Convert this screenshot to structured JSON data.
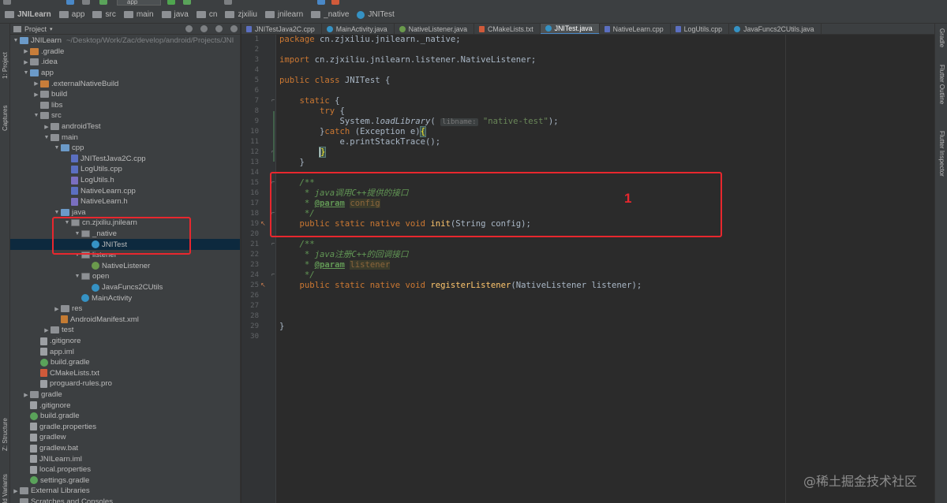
{
  "colors": {
    "annotation": "#e8272e",
    "keyword": "#cc7832",
    "string": "#6a8759",
    "comment": "#629755",
    "method": "#ffc66d",
    "selection": "#0d293e",
    "active_tab_underline": "#4a88c7"
  },
  "toolbar": {
    "run_config": "app"
  },
  "breadcrumb": [
    {
      "label": "JNILearn",
      "icon": "folder-icon"
    },
    {
      "label": "app",
      "icon": "folder-icon"
    },
    {
      "label": "src",
      "icon": "folder-icon"
    },
    {
      "label": "main",
      "icon": "folder-icon"
    },
    {
      "label": "java",
      "icon": "folder-icon"
    },
    {
      "label": "cn",
      "icon": "package-icon"
    },
    {
      "label": "zjxiliu",
      "icon": "package-icon"
    },
    {
      "label": "jnilearn",
      "icon": "package-icon"
    },
    {
      "label": "_native",
      "icon": "package-icon"
    },
    {
      "label": "JNITest",
      "icon": "class-icon"
    }
  ],
  "left_strip": {
    "project": "1: Project",
    "captures": "Captures",
    "structure": "Z: Structure",
    "build_variants": "Build Variants"
  },
  "right_strip": {
    "gradle": "Gradle",
    "flutter_outline": "Flutter Outline",
    "flutter_inspector": "Flutter Inspector"
  },
  "project_panel": {
    "title": "Project",
    "tree": [
      {
        "label": "JNILearn",
        "extra": "~/Desktop/Work/Zac/develop/android/Projects/JNI",
        "depth": 0,
        "arrow": "▼",
        "icon": "folder-blue"
      },
      {
        "label": ".gradle",
        "depth": 1,
        "arrow": "▶",
        "icon": "folder-orange"
      },
      {
        "label": ".idea",
        "depth": 1,
        "arrow": "▶",
        "icon": "folder"
      },
      {
        "label": "app",
        "depth": 1,
        "arrow": "▼",
        "icon": "folder-blue"
      },
      {
        "label": ".externalNativeBuild",
        "depth": 2,
        "arrow": "▶",
        "icon": "folder-orange"
      },
      {
        "label": "build",
        "depth": 2,
        "arrow": "▶",
        "icon": "folder"
      },
      {
        "label": "libs",
        "depth": 2,
        "arrow": "",
        "icon": "folder"
      },
      {
        "label": "src",
        "depth": 2,
        "arrow": "▼",
        "icon": "folder"
      },
      {
        "label": "androidTest",
        "depth": 3,
        "arrow": "▶",
        "icon": "folder"
      },
      {
        "label": "main",
        "depth": 3,
        "arrow": "▼",
        "icon": "folder"
      },
      {
        "label": "cpp",
        "depth": 4,
        "arrow": "▼",
        "icon": "folder-blue"
      },
      {
        "label": "JNITestJava2C.cpp",
        "depth": 5,
        "arrow": "",
        "icon": "cpp"
      },
      {
        "label": "LogUtils.cpp",
        "depth": 5,
        "arrow": "",
        "icon": "cpp"
      },
      {
        "label": "LogUtils.h",
        "depth": 5,
        "arrow": "",
        "icon": "h"
      },
      {
        "label": "NativeLearn.cpp",
        "depth": 5,
        "arrow": "",
        "icon": "cpp"
      },
      {
        "label": "NativeLearn.h",
        "depth": 5,
        "arrow": "",
        "icon": "h"
      },
      {
        "label": "java",
        "depth": 4,
        "arrow": "▼",
        "icon": "folder-blue"
      },
      {
        "label": "cn.zjxiliu.jnilearn",
        "depth": 5,
        "arrow": "▼",
        "icon": "pkg"
      },
      {
        "label": "_native",
        "depth": 6,
        "arrow": "▼",
        "icon": "pkg"
      },
      {
        "label": "JNITest",
        "depth": 7,
        "arrow": "",
        "icon": "cls",
        "selected": true
      },
      {
        "label": "listener",
        "depth": 6,
        "arrow": "▼",
        "icon": "pkg"
      },
      {
        "label": "NativeListener",
        "depth": 7,
        "arrow": "",
        "icon": "iface"
      },
      {
        "label": "open",
        "depth": 6,
        "arrow": "▼",
        "icon": "pkg"
      },
      {
        "label": "JavaFuncs2CUtils",
        "depth": 7,
        "arrow": "",
        "icon": "cls"
      },
      {
        "label": "MainActivity",
        "depth": 6,
        "arrow": "",
        "icon": "cls"
      },
      {
        "label": "res",
        "depth": 4,
        "arrow": "▶",
        "icon": "folder"
      },
      {
        "label": "AndroidManifest.xml",
        "depth": 4,
        "arrow": "",
        "icon": "xml"
      },
      {
        "label": "test",
        "depth": 3,
        "arrow": "▶",
        "icon": "folder"
      },
      {
        "label": ".gitignore",
        "depth": 2,
        "arrow": "",
        "icon": "file"
      },
      {
        "label": "app.iml",
        "depth": 2,
        "arrow": "",
        "icon": "file"
      },
      {
        "label": "build.gradle",
        "depth": 2,
        "arrow": "",
        "icon": "gradle"
      },
      {
        "label": "CMakeLists.txt",
        "depth": 2,
        "arrow": "",
        "icon": "cmake"
      },
      {
        "label": "proguard-rules.pro",
        "depth": 2,
        "arrow": "",
        "icon": "file"
      },
      {
        "label": "gradle",
        "depth": 1,
        "arrow": "▶",
        "icon": "folder"
      },
      {
        "label": ".gitignore",
        "depth": 1,
        "arrow": "",
        "icon": "file"
      },
      {
        "label": "build.gradle",
        "depth": 1,
        "arrow": "",
        "icon": "gradle"
      },
      {
        "label": "gradle.properties",
        "depth": 1,
        "arrow": "",
        "icon": "file"
      },
      {
        "label": "gradlew",
        "depth": 1,
        "arrow": "",
        "icon": "file"
      },
      {
        "label": "gradlew.bat",
        "depth": 1,
        "arrow": "",
        "icon": "file"
      },
      {
        "label": "JNILearn.iml",
        "depth": 1,
        "arrow": "",
        "icon": "file"
      },
      {
        "label": "local.properties",
        "depth": 1,
        "arrow": "",
        "icon": "file"
      },
      {
        "label": "settings.gradle",
        "depth": 1,
        "arrow": "",
        "icon": "gradle"
      },
      {
        "label": "External Libraries",
        "depth": 0,
        "arrow": "▶",
        "icon": "lib"
      },
      {
        "label": "Scratches and Consoles",
        "depth": 0,
        "arrow": "",
        "icon": "folder"
      }
    ]
  },
  "tabs": [
    {
      "label": "JNITestJava2C.cpp",
      "icon": "cpp"
    },
    {
      "label": "MainActivity.java",
      "icon": "cls"
    },
    {
      "label": "NativeListener.java",
      "icon": "iface"
    },
    {
      "label": "CMakeLists.txt",
      "icon": "cmake"
    },
    {
      "label": "JNITest.java",
      "icon": "cls",
      "active": true
    },
    {
      "label": "NativeLearn.cpp",
      "icon": "cpp"
    },
    {
      "label": "LogUtils.cpp",
      "icon": "cpp"
    },
    {
      "label": "JavaFuncs2CUtils.java",
      "icon": "cls"
    }
  ],
  "editor": {
    "line_numbers": [
      "1",
      "2",
      "3",
      "4",
      "5",
      "6",
      "7",
      "8",
      "9",
      "10",
      "11",
      "12",
      "13",
      "14",
      "15",
      "16",
      "17",
      "18",
      "19",
      "20",
      "21",
      "22",
      "23",
      "24",
      "25",
      "26",
      "27",
      "28",
      "29",
      "30"
    ],
    "code": {
      "l1_kw": "package",
      "l1_rest": " cn.zjxiliu.jnilearn._native;",
      "l3_kw": "import",
      "l3_rest": " cn.zjxiliu.jnilearn.listener.NativeListener;",
      "l5_kw": "public class",
      "l5_rest": " JNITest {",
      "l7_kw": "static",
      "l7_rest": " {",
      "l8_kw": "try",
      "l8_rest": " {",
      "l9_pre": "System.",
      "l9_method": "loadLibrary",
      "l9_paren": "(",
      "l9_hint": "libname:",
      "l9_str": "\"native-test\"",
      "l9_post": ");",
      "l10_brace": "}",
      "l10_kw": "catch",
      "l10_mid": " (Exception e)",
      "l10_open": "{",
      "l11": "e.printStackTrace();",
      "l12": "}",
      "l13": "}",
      "l15": "/**",
      "l16_star": " * ",
      "l16_text": "java调用C++提供的接口",
      "l17_star": " * ",
      "l17_tag": "@param",
      "l17_name": "config",
      "l18": " */",
      "l19_kw": "public static native void",
      "l19_fn": "init",
      "l19_rest": "(String config);",
      "l21": "/**",
      "l22_star": " * ",
      "l22_text": "java注册C++的回调接口",
      "l23_star": " * ",
      "l23_tag": "@param",
      "l23_name": "listener",
      "l24": " */",
      "l25_kw": "public static native void",
      "l25_fn": "registerListener",
      "l25_rest": "(NativeListener listener);",
      "l29": "}"
    }
  },
  "annotation": {
    "number": "1"
  },
  "watermark": "@稀土掘金技术社区"
}
